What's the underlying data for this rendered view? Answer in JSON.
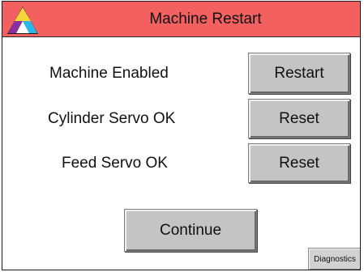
{
  "header": {
    "title": "Machine Restart",
    "logo_icon": "tri-color-triangle-logo",
    "bar_color": "#f2605f"
  },
  "rows": [
    {
      "label": "Machine Enabled",
      "button_label": "Restart"
    },
    {
      "label": "Cylinder Servo OK",
      "button_label": "Reset"
    },
    {
      "label": "Feed Servo OK",
      "button_label": "Reset"
    }
  ],
  "continue_label": "Continue",
  "diagnostics_label": "Diagnostics"
}
